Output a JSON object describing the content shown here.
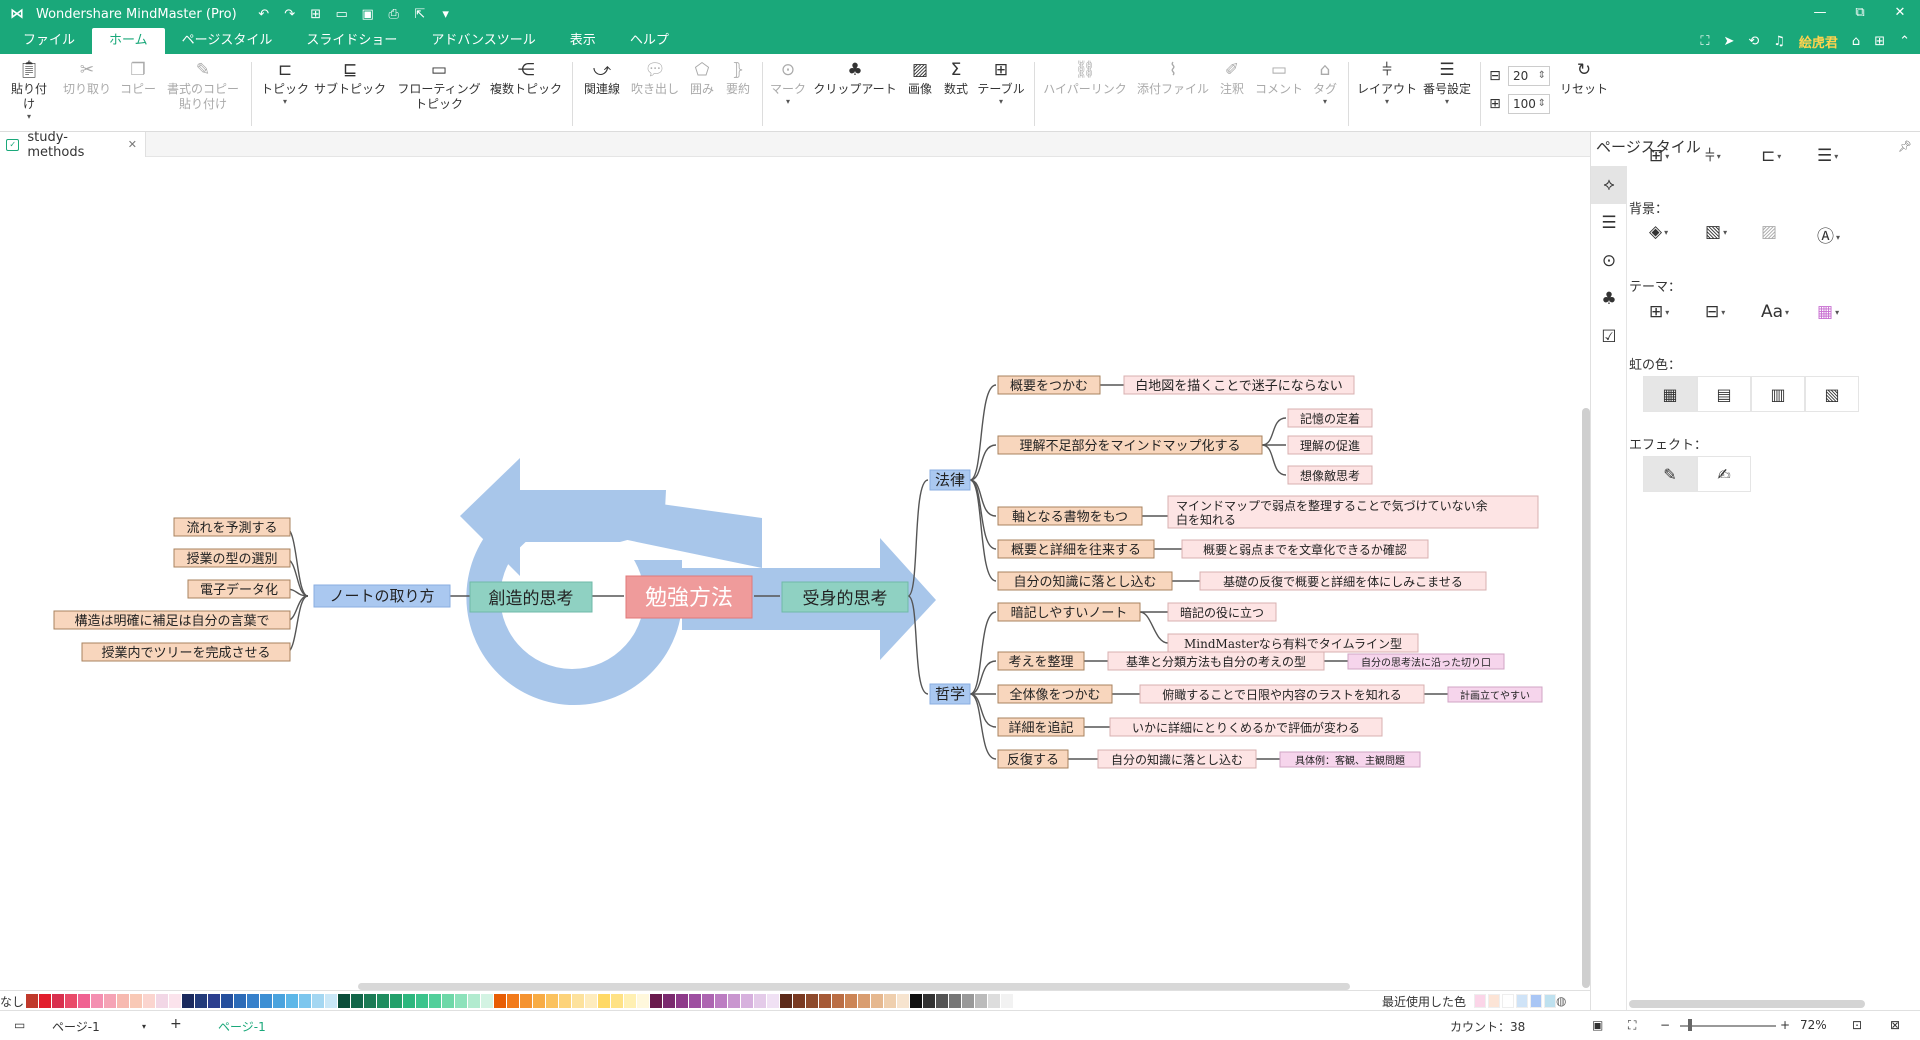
{
  "app": {
    "title": "Wondershare MindMaster (Pro)"
  },
  "window_controls": [
    "—",
    "▫",
    "⧉",
    "✕"
  ],
  "menu": {
    "items": [
      "ファイル",
      "ホーム",
      "ページスタイル",
      "スライドショー",
      "アドバンスツール",
      "表示",
      "ヘルプ"
    ],
    "active": "ホーム",
    "user": "絵虎君"
  },
  "ribbon": {
    "paste": "貼り付け",
    "cut": "切り取り",
    "copy": "コピー",
    "format_copy_1": "書式のコピー",
    "format_copy_2": "貼り付け",
    "topic": "トピック",
    "subtopic": "サブトピック",
    "floating_1": "フローティング",
    "floating_2": "トピック",
    "multi_topic": "複数トピック",
    "relation": "関連線",
    "callout": "吹き出し",
    "boundary": "囲み",
    "summary": "要約",
    "mark": "マーク",
    "clipart": "クリップアート",
    "image": "画像",
    "formula": "数式",
    "table": "テーブル",
    "hyperlink": "ハイパーリンク",
    "attachment": "添付ファイル",
    "note": "注釈",
    "comment": "コメント",
    "tag": "タグ",
    "layout": "レイアウト",
    "numbering": "番号設定",
    "spacing_h": "20",
    "spacing_v": "100",
    "reset": "リセット"
  },
  "doc_tab": {
    "name": "study-methods"
  },
  "mindmap": {
    "central": "勉強方法",
    "left_main": "創造的思考",
    "left_sub": "ノートの取り方",
    "left_leaves": [
      "流れを予測する",
      "授業の型の選別",
      "電子データ化",
      "構造は明確に補足は自分の言葉で",
      "授業内でツリーを完成させる"
    ],
    "right_main": "受身的思考",
    "law": {
      "label": "法律",
      "items": [
        {
          "label": "概要をつかむ",
          "sub": [
            "白地図を描くことで迷子にならない"
          ]
        },
        {
          "label": "理解不足部分をマインドマップ化する",
          "sub": [
            "記憶の定着",
            "理解の促進",
            "想像敵思考"
          ]
        },
        {
          "label": "軸となる書物をもつ",
          "sub": [
            "マインドマップで弱点を整理することで気づけていない余",
            "白を知れる"
          ]
        },
        {
          "label": "概要と詳細を往来する",
          "sub": [
            "概要と弱点までを文章化できるか確認"
          ]
        },
        {
          "label": "自分の知識に落とし込む",
          "sub": [
            "基礎の反復で概要と詳細を体にしみこませる"
          ]
        }
      ]
    },
    "phil": {
      "label": "哲学",
      "items": [
        {
          "label": "暗記しやすいノート",
          "sub": [
            "暗記の役に立つ",
            "MindMasterなら有料でタイムライン型"
          ]
        },
        {
          "label": "考えを整理",
          "sub": [
            "基準と分類方法も自分の考えの型",
            "自分の思考法に沿った切り口"
          ]
        },
        {
          "label": "全体像をつかむ",
          "sub": [
            "俯瞰することで日限や内容のラストを知れる",
            "計画立てやすい"
          ]
        },
        {
          "label": "詳細を追記",
          "sub": [
            "いかに詳細にとりくめるかで評価が変わる"
          ]
        },
        {
          "label": "反復する",
          "sub": [
            "自分の知識に落とし込む",
            "具体例：客観、主観問題"
          ]
        }
      ]
    }
  },
  "right_panel": {
    "title": "ページスタイル",
    "background_label": "背景：",
    "theme_label": "テーマ：",
    "rainbow_label": "虹の色：",
    "effect_label": "エフェクト："
  },
  "color_strip": {
    "label": "なし",
    "recent_label": "最近使用した色",
    "colors": [
      "#c0392b",
      "#e21e2d",
      "#d9304e",
      "#e94b6a",
      "#f06292",
      "#f48fb1",
      "#f5a3b5",
      "#f7b9b0",
      "#f9c9b6",
      "#fbd5cf",
      "#f2d7e6",
      "#fbe3ec",
      "#1b2a5e",
      "#233b7a",
      "#2c3f8f",
      "#254f9d",
      "#2c6bb8",
      "#3680cb",
      "#3d8fd4",
      "#4aa3de",
      "#5db7e8",
      "#7cc6ee",
      "#a4d7f2",
      "#c9e7f7",
      "#0b4d3a",
      "#126649",
      "#1b7b55",
      "#1f8d5f",
      "#24a06b",
      "#2db77e",
      "#3cc48c",
      "#52cf9a",
      "#6ed8a8",
      "#8de2bb",
      "#b2ebcf",
      "#d3f3e3",
      "#e85d04",
      "#f27a1a",
      "#f59331",
      "#f8ac45",
      "#fbc25e",
      "#fdd37a",
      "#fde29d",
      "#feecbd",
      "#ffd966",
      "#ffe285",
      "#fff0b3",
      "#fff8dc",
      "#6a1b4d",
      "#7b2a6f",
      "#8e3a8a",
      "#9e4fa1",
      "#ad65b1",
      "#bc7dc2",
      "#c996cf",
      "#d7b1de",
      "#e4cbe9",
      "#f0e1f4",
      "#5d2a1a",
      "#7a3a22",
      "#8e4a2c",
      "#a65a37",
      "#bb6e45",
      "#cc8556",
      "#d99d70",
      "#e6b88f",
      "#efcfae",
      "#f7e4cf",
      "#111111",
      "#333333",
      "#555555",
      "#777777",
      "#999999",
      "#bbbbbb",
      "#dddddd",
      "#f2f2f2",
      "#ffffff"
    ],
    "recent": [
      "#fbd5e8",
      "#fce4d6",
      "#ffffff",
      "#cfe3f7",
      "#a9c6f5",
      "#bfe1ef"
    ]
  },
  "status": {
    "page_select": "ページ-1",
    "page_tab": "ページ-1",
    "count": "カウント：38",
    "zoom": "72%"
  }
}
